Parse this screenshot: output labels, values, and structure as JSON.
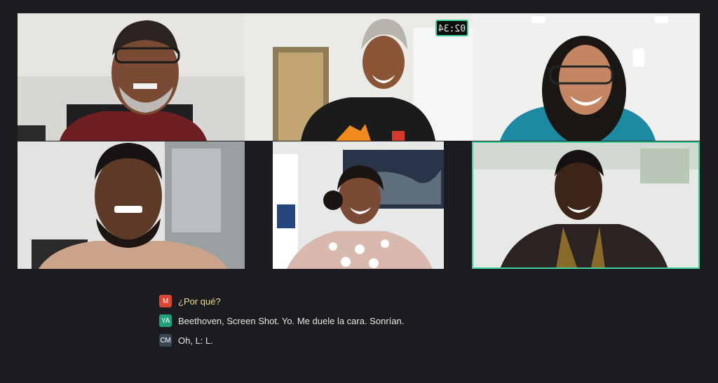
{
  "call": {
    "timer_text": "02:34",
    "active_color": "#3ed19a"
  },
  "captions": [
    {
      "initials": "M",
      "badge_color": "#d94636",
      "text": "¿Por qué?"
    },
    {
      "initials": "YA",
      "badge_color": "#1f9f7a",
      "text": "Beethoven, Screen Shot. Yo. Me duele la cara. Sonrían."
    },
    {
      "initials": "CM",
      "badge_color": "#3b4654",
      "text": "Oh, L: L."
    }
  ]
}
